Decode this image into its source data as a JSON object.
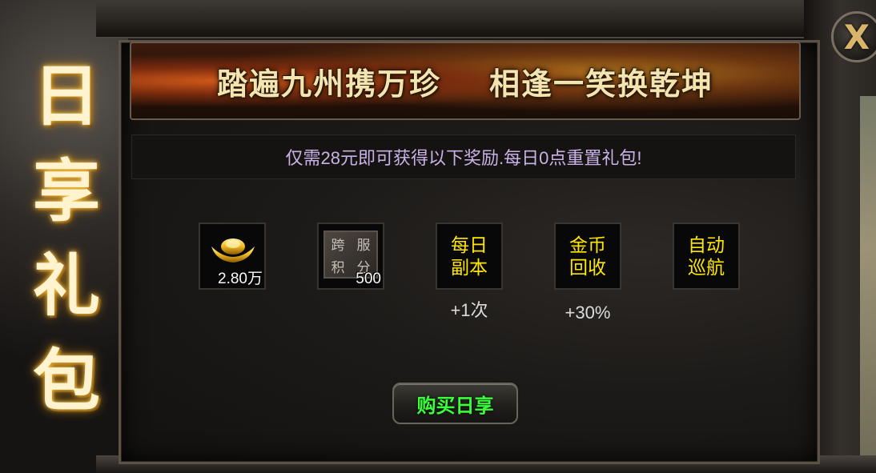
{
  "title_chars": [
    "日",
    "享",
    "礼",
    "包"
  ],
  "banner": {
    "left": "踏遍九州携万珍",
    "right": "相逢一笑换乾坤"
  },
  "info": "仅需28元即可获得以下奖励.每日0点重置礼包!",
  "close_label": "X",
  "rewards": [
    {
      "icon": "gold-ingot-icon",
      "count": "2.80万",
      "below": ""
    },
    {
      "icon": "cross-server-points-icon",
      "icon_text": [
        "跨",
        "服",
        "积",
        "分"
      ],
      "count": "500",
      "below": ""
    },
    {
      "label_lines": [
        "每日",
        "副本"
      ],
      "below": "+1次"
    },
    {
      "label_lines": [
        "金币",
        "回收"
      ],
      "below": "+30%"
    },
    {
      "label_lines": [
        "自动",
        "巡航"
      ],
      "below": ""
    }
  ],
  "buy_button": "购买日享",
  "colors": {
    "info_text": "#c9b2e6",
    "item_label": "#ffe600",
    "buy_text": "#3aff3a",
    "title_glow": "#ffcf55"
  }
}
